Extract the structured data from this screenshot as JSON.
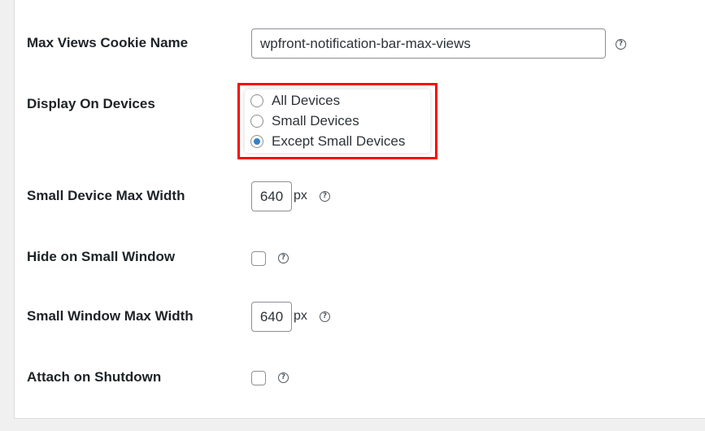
{
  "settings": {
    "max_views_cookie": {
      "label": "Max Views Cookie Name",
      "value": "wpfront-notification-bar-max-views",
      "help": "?"
    },
    "display_on_devices": {
      "label": "Display On Devices",
      "options": [
        {
          "label": "All Devices",
          "checked": false
        },
        {
          "label": "Small Devices",
          "checked": false
        },
        {
          "label": "Except Small Devices",
          "checked": true
        }
      ],
      "highlight_color": "#ff0000"
    },
    "small_device_max_width": {
      "label": "Small Device Max Width",
      "value": "640",
      "unit": "px",
      "help": "?"
    },
    "hide_on_small_window": {
      "label": "Hide on Small Window",
      "checked": false,
      "help": "?"
    },
    "small_window_max_width": {
      "label": "Small Window Max Width",
      "value": "640",
      "unit": "px",
      "help": "?"
    },
    "attach_on_shutdown": {
      "label": "Attach on Shutdown",
      "checked": false,
      "help": "?"
    }
  },
  "colors": {
    "radio_checked": "#3582c4",
    "text": "#1d2327",
    "border": "#8c8f94"
  }
}
